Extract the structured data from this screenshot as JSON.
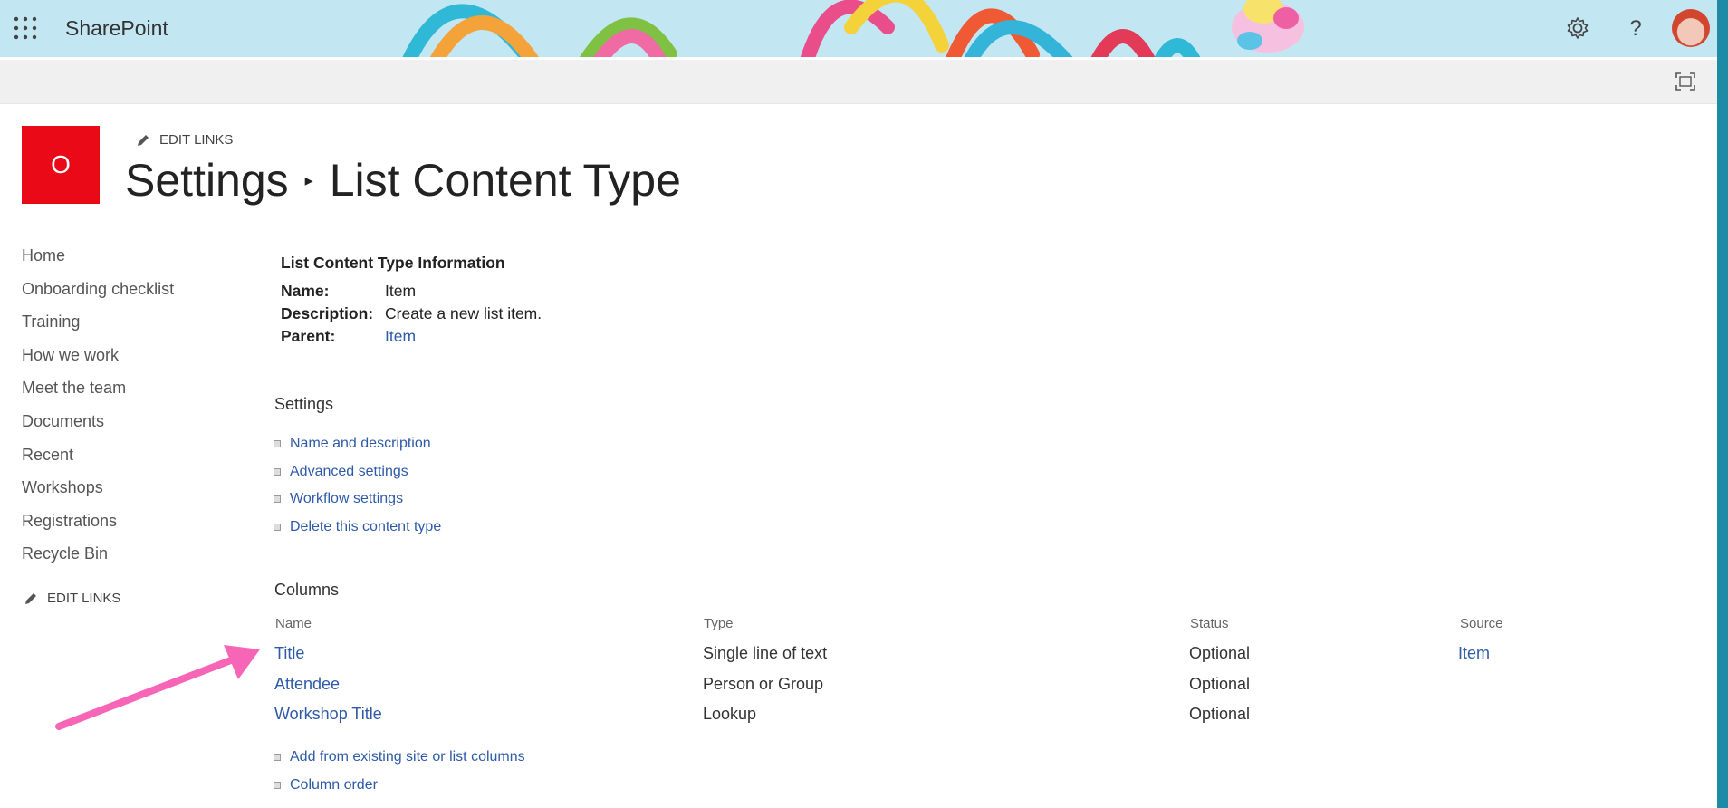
{
  "suitebar": {
    "brand": "SharePoint",
    "icons": [
      "waffle-icon",
      "settings-gear-icon",
      "help-question-icon",
      "user-avatar"
    ]
  },
  "site": {
    "logo_letter": "O",
    "edit_links": "EDIT LINKS",
    "title_parent": "Settings",
    "title_current": "List Content Type"
  },
  "leftnav": {
    "items": [
      "Home",
      "Onboarding checklist",
      "Training",
      "How we work",
      "Meet the team",
      "Documents",
      "Recent",
      "Workshops",
      "Registrations",
      "Recycle Bin"
    ],
    "edit_links": "EDIT LINKS"
  },
  "info": {
    "heading": "List Content Type Information",
    "name_label": "Name:",
    "name_value": "Item",
    "description_label": "Description:",
    "description_value": "Create a new list item.",
    "parent_label": "Parent:",
    "parent_value": "Item"
  },
  "settings": {
    "title": "Settings",
    "links": [
      "Name and description",
      "Advanced settings",
      "Workflow settings",
      "Delete this content type"
    ]
  },
  "columns": {
    "title": "Columns",
    "headers": [
      "Name",
      "Type",
      "Status",
      "Source"
    ],
    "rows": [
      {
        "name": "Title",
        "type": "Single line of text",
        "status": "Optional",
        "source": "Item"
      },
      {
        "name": "Attendee",
        "type": "Person or Group",
        "status": "Optional",
        "source": ""
      },
      {
        "name": "Workshop Title",
        "type": "Lookup",
        "status": "Optional",
        "source": ""
      }
    ],
    "links": [
      "Add from existing site or list columns",
      "Column order"
    ]
  },
  "colors": {
    "accent_link": "#2e5aa8",
    "site_logo": "#e90917",
    "suitebar": "#c3e6f3",
    "annotation_arrow": "#f766b6"
  }
}
